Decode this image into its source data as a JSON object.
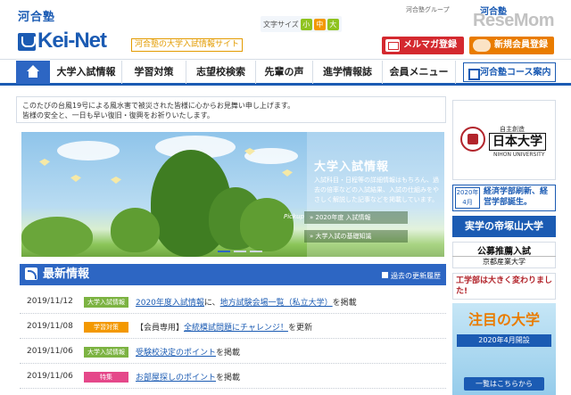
{
  "header": {
    "brand_kawai": "河合塾",
    "brand_name": "Kei-Net",
    "tagline": "河合塾の大学入試情報サイト",
    "font_size_label": "文字サイズ",
    "font_sizes": [
      "小",
      "中",
      "大"
    ],
    "group_label": "河合塾グループ",
    "group_logo": "河合塾",
    "watermark": "ReseMom",
    "mailmag_label": "メルマガ登録",
    "member_label": "新規会員登録"
  },
  "nav": {
    "home_icon": "home-icon",
    "items": [
      "大学入試情報",
      "学習対策",
      "志望校検索",
      "先輩の声",
      "進学情報誌",
      "会員メニュー"
    ],
    "course_label": "河合塾コース案内"
  },
  "notice": {
    "line1": "このたびの台風19号による風水害で被災された皆様に心からお見舞い申し上げます。",
    "line2": "皆様の安全と、一日も早い復旧・復興をお祈りいたします。"
  },
  "hero": {
    "title": "大学入試情報",
    "desc": "入試科目・日程等の詳細情報はもちろん、過去の倍率などの入試結果、入試の仕組みをやさしく解説した記事などを掲載しています。",
    "pickup": "Pickup",
    "link1": "» 2020年度 入試情報",
    "link2": "» 大学入試の基礎知識"
  },
  "latest": {
    "title": "最新情報",
    "past_link": "過去の更新履歴",
    "rows": [
      {
        "date": "2019/11/12",
        "tag": "大学入試情報",
        "tag_color": "#7cb342",
        "link1": "2020年度入試情報",
        "mid": "に、",
        "link2": "地方試験会場一覧（私立大学）",
        "tail": "を掲載"
      },
      {
        "date": "2019/11/08",
        "tag": "学習対策",
        "tag_color": "#f39800",
        "prefix": "【会員専用】",
        "link1": "全統模試問題にチャレンジ！",
        "mid": "",
        "link2": "",
        "tail": "を更新"
      },
      {
        "date": "2019/11/06",
        "tag": "大学入試情報",
        "tag_color": "#7cb342",
        "link1": "受験校決定のポイント",
        "mid": "",
        "link2": "",
        "tail": "を掲載"
      },
      {
        "date": "2019/11/06",
        "tag": "特集",
        "tag_color": "#e5488a",
        "link1": "お部屋探しのポイント",
        "mid": "",
        "link2": "",
        "tail": "を掲載"
      }
    ]
  },
  "sidebar": {
    "nihon_sub": "自主創造",
    "nihon_name": "日本大学",
    "nihon_en": "NIHON UNIVERSITY",
    "keizai_date": "2020年 4月",
    "keizai_text": "経済学部刷新、経営学部誕生。",
    "teikyo": "実学の帝塚山大学",
    "kyoto_line1": "公募推薦入試",
    "kyoto_line2": "京都産業大学",
    "tokyoeng": "工学部は大きく変わりました!",
    "chumoku_title": "注目の大学",
    "chumoku_band": "2020年4月開設",
    "chumoku_btn": "一覧はこちらから"
  }
}
